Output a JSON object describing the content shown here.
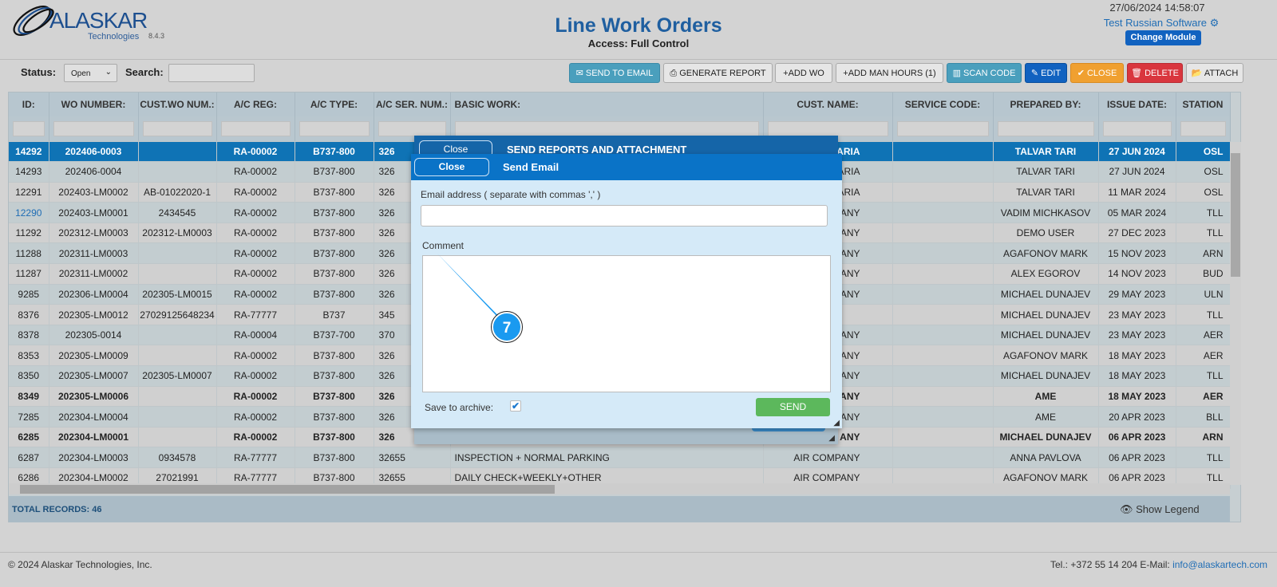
{
  "header": {
    "logo_text": "ALASKAR",
    "logo_sub": "Technologies",
    "version": "8.4.3",
    "title": "Line Work Orders",
    "access": "Access: Full Control",
    "datetime": "27/06/2024 14:58:07",
    "user": "Test Russian Software",
    "change_module": "Change Module"
  },
  "toolbar": {
    "status_label": "Status:",
    "status_value": "Open",
    "search_label": "Search:",
    "search_value": "",
    "buttons": [
      "SEND TO EMAIL",
      "GENERATE REPORT",
      "ADD WO",
      "ADD MAN HOURS (1)",
      "SCAN CODE",
      "EDIT",
      "CLOSE",
      "DELETE",
      "ATTACH"
    ]
  },
  "table": {
    "columns": [
      "ID:",
      "WO NUMBER:",
      "CUST.WO NUM.:",
      "A/C REG:",
      "A/C TYPE:",
      "A/C SER. NUM.:",
      "BASIC WORK:",
      "CUST. NAME:",
      "SERVICE CODE:",
      "PREPARED BY:",
      "ISSUE DATE:",
      "STATION"
    ],
    "rows": [
      [
        "14292",
        "202406-0003",
        "",
        "RA-00002",
        "B737-800",
        "326",
        "",
        "ARIA",
        "",
        "TALVAR TARI",
        "27 JUN 2024",
        "OSL"
      ],
      [
        "14293",
        "202406-0004",
        "",
        "RA-00002",
        "B737-800",
        "326",
        "",
        "ARIA",
        "",
        "TALVAR TARI",
        "27 JUN 2024",
        "OSL"
      ],
      [
        "12291",
        "202403-LM0002",
        "AB-01022020-1",
        "RA-00002",
        "B737-800",
        "326",
        "",
        "ARIA",
        "",
        "TALVAR TARI",
        "11 MAR 2024",
        "OSL"
      ],
      [
        "12290",
        "202403-LM0001",
        "2434545",
        "RA-00002",
        "B737-800",
        "326",
        "",
        "ANY",
        "",
        "VADIM MICHKASOV",
        "05 MAR 2024",
        "TLL"
      ],
      [
        "11292",
        "202312-LM0003",
        "202312-LM0003",
        "RA-00002",
        "B737-800",
        "326",
        "",
        "ANY",
        "",
        "DEMO USER",
        "27 DEC 2023",
        "TLL"
      ],
      [
        "11288",
        "202311-LM0003",
        "",
        "RA-00002",
        "B737-800",
        "326",
        "",
        "ANY",
        "",
        "AGAFONOV MARK",
        "15 NOV 2023",
        "ARN"
      ],
      [
        "11287",
        "202311-LM0002",
        "",
        "RA-00002",
        "B737-800",
        "326",
        "",
        "ANY",
        "",
        "ALEX EGOROV",
        "14 NOV 2023",
        "BUD"
      ],
      [
        "9285",
        "202306-LM0004",
        "202305-LM0015",
        "RA-00002",
        "B737-800",
        "326",
        "",
        "ANY",
        "",
        "MICHAEL DUNAJEV",
        "29 MAY 2023",
        "ULN"
      ],
      [
        "8376",
        "202305-LM0012",
        "27029125648234",
        "RA-77777",
        "B737",
        "345",
        "",
        "",
        "",
        "MICHAEL DUNAJEV",
        "23 MAY 2023",
        "TLL"
      ],
      [
        "8378",
        "202305-0014",
        "",
        "RA-00004",
        "B737-700",
        "370",
        "",
        "ANY",
        "",
        "MICHAEL DUNAJEV",
        "23 MAY 2023",
        "AER"
      ],
      [
        "8353",
        "202305-LM0009",
        "",
        "RA-00002",
        "B737-800",
        "326",
        "",
        "ANY",
        "",
        "AGAFONOV MARK",
        "18 MAY 2023",
        "AER"
      ],
      [
        "8350",
        "202305-LM0007",
        "202305-LM0007",
        "RA-00002",
        "B737-800",
        "326",
        "",
        "ANY",
        "",
        "MICHAEL DUNAJEV",
        "18 MAY 2023",
        "TLL"
      ],
      [
        "8349",
        "202305-LM0006",
        "",
        "RA-00002",
        "B737-800",
        "326",
        "",
        "ANY",
        "",
        "AME",
        "18 MAY 2023",
        "AER"
      ],
      [
        "7285",
        "202304-LM0004",
        "",
        "RA-00002",
        "B737-800",
        "326",
        "",
        "ANY",
        "",
        "AME",
        "20 APR 2023",
        "BLL"
      ],
      [
        "6285",
        "202304-LM0001",
        "",
        "RA-00002",
        "B737-800",
        "326",
        "",
        "ANY",
        "",
        "MICHAEL DUNAJEV",
        "06 APR 2023",
        "ARN"
      ],
      [
        "6287",
        "202304-LM0003",
        "0934578",
        "RA-77777",
        "B737-800",
        "32655",
        "INSPECTION + NORMAL PARKING",
        "AIR COMPANY",
        "",
        "ANNA PAVLOVA",
        "06 APR 2023",
        "TLL"
      ],
      [
        "6286",
        "202304-LM0002",
        "27021991",
        "RA-77777",
        "B737-800",
        "32655",
        "DAILY CHECK+WEEKLY+OTHER",
        "AIR COMPANY",
        "",
        "AGAFONOV MARK",
        "06 APR 2023",
        "TLL"
      ]
    ],
    "bold_rows": [
      12,
      14
    ],
    "selected_row": 0,
    "link_row": 3,
    "total": "TOTAL RECORDS: 46",
    "show_legend": "Show Legend"
  },
  "back_dialog": {
    "close": "Close",
    "title": "SEND REPORTS AND ATTACHMENT"
  },
  "dialog": {
    "close": "Close",
    "title": "Send Email",
    "email_label": "Email address ( separate with commas ',' )",
    "email_value": "",
    "comment_label": "Comment",
    "comment_value": "",
    "archive_label": "Save to archive:",
    "archive_checked": true,
    "send": "SEND"
  },
  "annotation": {
    "number": "7",
    "color": "#1a9af0"
  },
  "footer": {
    "copyright": "© 2024 Alaskar Technologies, Inc.",
    "contact": "Tel.: +372 55 14 204 E-Mail: ",
    "email": "info@alaskartech.com"
  }
}
